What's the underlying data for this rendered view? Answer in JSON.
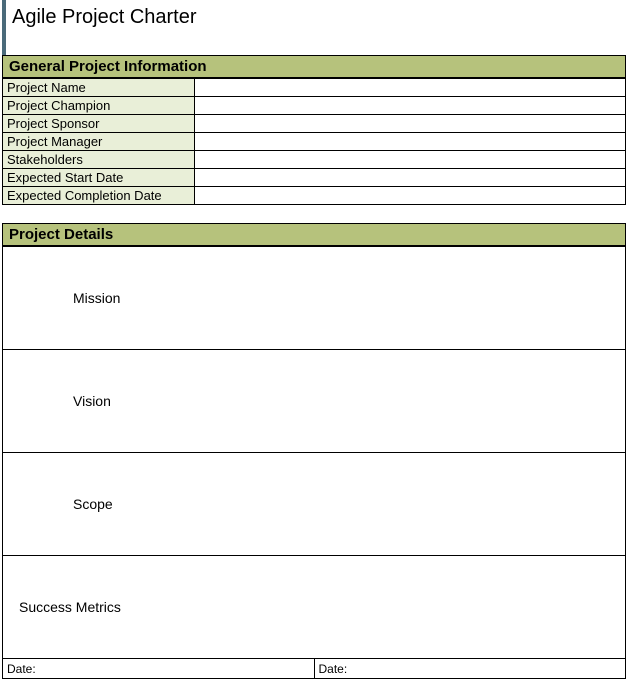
{
  "title": "Agile Project Charter",
  "sections": {
    "general": {
      "header": "General Project Information",
      "rows": [
        {
          "label": "Project Name",
          "value": ""
        },
        {
          "label": "Project Champion",
          "value": ""
        },
        {
          "label": "Project Sponsor",
          "value": ""
        },
        {
          "label": "Project Manager",
          "value": ""
        },
        {
          "label": "Stakeholders",
          "value": ""
        },
        {
          "label": "Expected Start Date",
          "value": ""
        },
        {
          "label": "Expected Completion Date",
          "value": ""
        }
      ]
    },
    "details": {
      "header": "Project Details",
      "rows": [
        {
          "label": "Mission"
        },
        {
          "label": "Vision"
        },
        {
          "label": "Scope"
        },
        {
          "label": "Success Metrics"
        }
      ]
    },
    "dates": {
      "left_label": "Date:",
      "left_value": "",
      "right_label": "Date:",
      "right_value": ""
    }
  }
}
